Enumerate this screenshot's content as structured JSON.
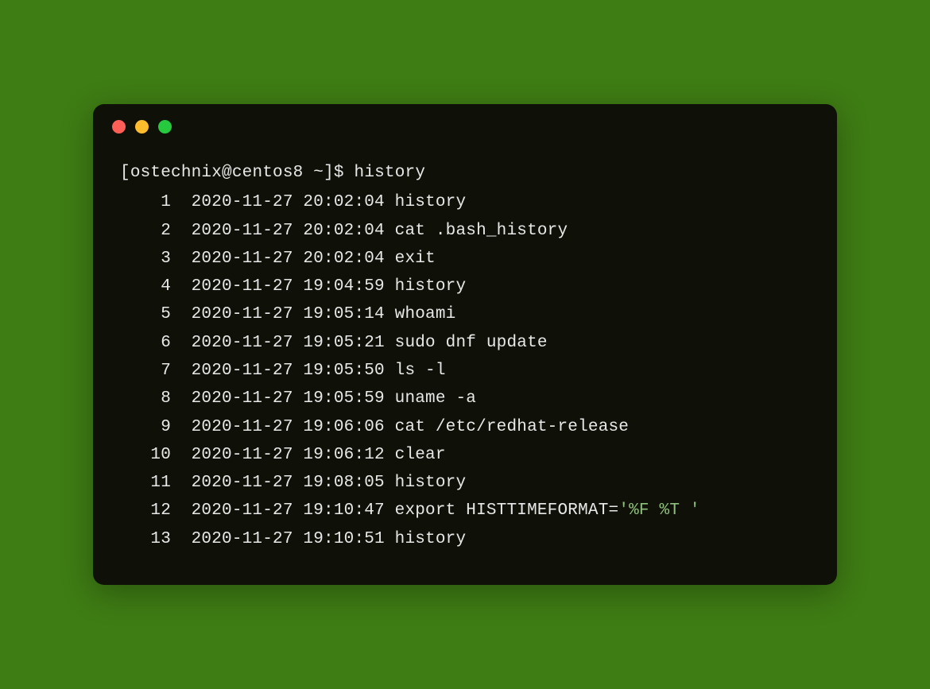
{
  "prompt": {
    "user": "ostechnix",
    "host": "centos8",
    "path": "~",
    "symbol": "$",
    "command": "history"
  },
  "history": [
    {
      "num": "1",
      "timestamp": "2020-11-27 20:02:04",
      "cmd": "history"
    },
    {
      "num": "2",
      "timestamp": "2020-11-27 20:02:04",
      "cmd": "cat .bash_history"
    },
    {
      "num": "3",
      "timestamp": "2020-11-27 20:02:04",
      "cmd": "exit"
    },
    {
      "num": "4",
      "timestamp": "2020-11-27 19:04:59",
      "cmd": "history"
    },
    {
      "num": "5",
      "timestamp": "2020-11-27 19:05:14",
      "cmd": "whoami"
    },
    {
      "num": "6",
      "timestamp": "2020-11-27 19:05:21",
      "cmd": "sudo dnf update"
    },
    {
      "num": "7",
      "timestamp": "2020-11-27 19:05:50",
      "cmd": "ls -l"
    },
    {
      "num": "8",
      "timestamp": "2020-11-27 19:05:59",
      "cmd": "uname -a"
    },
    {
      "num": "9",
      "timestamp": "2020-11-27 19:06:06",
      "cmd": "cat /etc/redhat-release"
    },
    {
      "num": "10",
      "timestamp": "2020-11-27 19:06:12",
      "cmd": "clear"
    },
    {
      "num": "11",
      "timestamp": "2020-11-27 19:08:05",
      "cmd": "history"
    },
    {
      "num": "12",
      "timestamp": "2020-11-27 19:10:47",
      "cmd": "export HISTTIMEFORMAT=",
      "quoted": "'%F %T '"
    },
    {
      "num": "13",
      "timestamp": "2020-11-27 19:10:51",
      "cmd": "history"
    }
  ],
  "colors": {
    "background": "#3e7c14",
    "terminal_bg": "#0f1108",
    "text": "#e8e8e8",
    "highlight": "#8ec07c"
  }
}
